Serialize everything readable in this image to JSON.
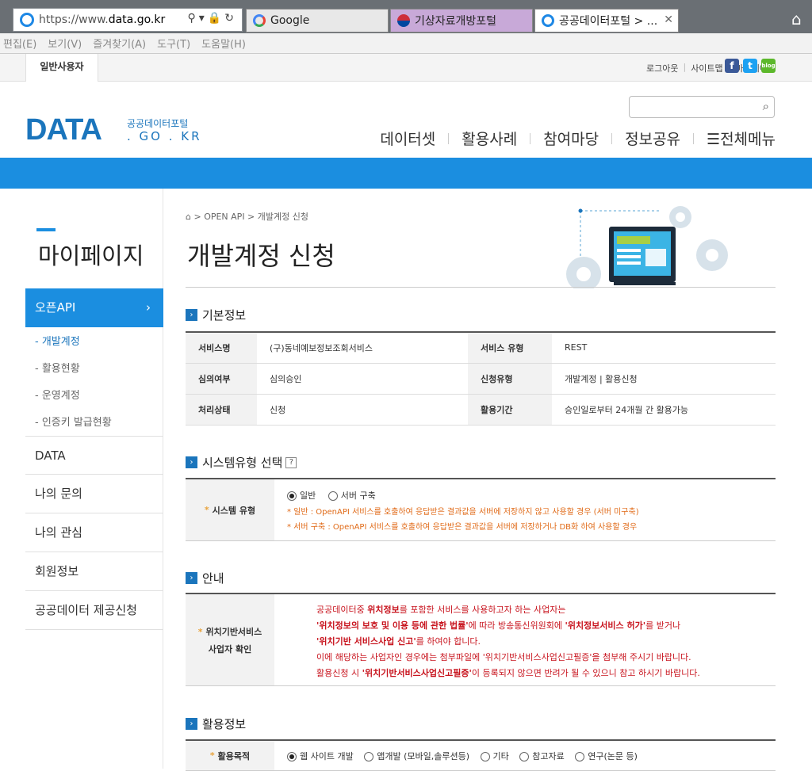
{
  "browser": {
    "url_proto": "https://www.",
    "url_host": "data.go.kr",
    "tabs": [
      "Google",
      "기상자료개방포털",
      "공공데이터포털 > ..."
    ],
    "menu": [
      "편집(E)",
      "보기(V)",
      "즐겨찾기(A)",
      "도구(T)",
      "도움말(H)"
    ]
  },
  "util": {
    "user_tab": "일반사용자",
    "links": [
      "로그아웃",
      "사이트맵",
      "마이페이지"
    ],
    "blog": "blog"
  },
  "header": {
    "logo_main": "DATA",
    "logo_sub1": "공공데이터포털",
    "logo_sub2": ". GO . KR",
    "nav": [
      "데이터셋",
      "활용사례",
      "참여마당",
      "정보공유",
      "☰전체메뉴"
    ]
  },
  "sidebar": {
    "title": "마이페이지",
    "active": "오픈API",
    "subs": [
      "- 개발계정",
      "- 활용현황",
      "- 운영계정",
      "- 인증키 발급현황"
    ],
    "items": [
      "DATA",
      "나의 문의",
      "나의 관심",
      "회원정보",
      "공공데이터 제공신청"
    ]
  },
  "main": {
    "breadcrumb": "⌂ > OPEN API > 개발계정 신청",
    "title": "개발계정 신청",
    "basic": {
      "heading": "기본정보",
      "rows": [
        [
          "서비스명",
          "(구)동네예보정보조회서비스",
          "서비스 유형",
          "REST"
        ],
        [
          "심의여부",
          "심의승인",
          "신청유형",
          "개발계정 | 활용신청"
        ],
        [
          "처리상태",
          "신청",
          "활용기간",
          "승인일로부터 24개월 간 활용가능"
        ]
      ]
    },
    "system": {
      "heading": "시스템유형 선택",
      "help": "?",
      "label": "시스템 유형",
      "opt1": "일반",
      "opt2": "서버 구축",
      "note1": "* 일반 : OpenAPI 서비스를 호출하여 응답받은 결과값을 서버에 저장하지 않고 사용할 경우 (서버 미구축)",
      "note2": "* 서버 구축 : OpenAPI 서비스를 호출하여 응답받은 결과값을 서버에 저장하거나 DB화 하여 사용할 경우"
    },
    "notice": {
      "heading": "안내",
      "label1": "위치기반서비스",
      "label2": "사업자 확인",
      "l1a": "공공데이터중 ",
      "l1b": "위치정보",
      "l1c": "를 포함한 서비스를 사용하고자 하는 사업자는",
      "l2a": "'위치정보의 보호 및 이용 등에 관한 법률'",
      "l2b": "에 따라 방송통신위원회에 ",
      "l2c": "'위치정보서비스 허가'",
      "l2d": "를 받거나",
      "l3a": "'위치기반 서비스사업 신고'",
      "l3b": "를 하여야 합니다.",
      "l4": "이에 해당하는 사업자인 경우에는 첨부파일에 '위치기반서비스사업신고필증'을 첨부해 주시기 바랍니다.",
      "l5a": "활용신청 시 ",
      "l5b": "'위치기반서비스사업신고필증'",
      "l5c": "이 등록되지 않으면 반려가 될 수 있으니 참고 하시기 바랍니다."
    },
    "usage": {
      "heading": "활용정보",
      "label": "활용목적",
      "options": [
        "웹 사이트 개발",
        "앱개발 (모바일,솔루션등)",
        "기타",
        "참고자료",
        "연구(논문 등)"
      ]
    }
  }
}
